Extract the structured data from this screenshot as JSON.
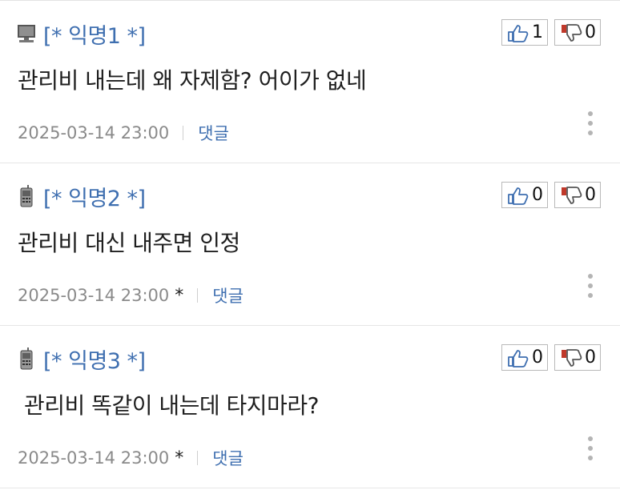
{
  "comments": [
    {
      "device_icon": "pc-monitor-icon",
      "author": "[* 익명1 *]",
      "likes": "1",
      "dislikes": "0",
      "text": "관리비 내는데 왜 자제함? 어이가 없네",
      "date": "2025-03-14 23:00",
      "star": "",
      "reply_label": "댓글"
    },
    {
      "device_icon": "mobile-phone-icon",
      "author": "[* 익명2 *]",
      "likes": "0",
      "dislikes": "0",
      "text": "관리비 대신 내주면 인정",
      "date": "2025-03-14 23:00",
      "star": "*",
      "reply_label": "댓글"
    },
    {
      "device_icon": "mobile-phone-icon",
      "author": "[* 익명3 *]",
      "likes": "0",
      "dislikes": "0",
      "text": "관리비 똑같이 내는데 타지마라?",
      "date": "2025-03-14 23:00",
      "star": "*",
      "reply_label": "댓글"
    }
  ],
  "colors": {
    "author": "#3f6fb0",
    "reply_link": "#3f6fb0",
    "date": "#8a8a8a",
    "thumb_up": "#3f6fb0",
    "thumb_down": "#c0392b"
  }
}
